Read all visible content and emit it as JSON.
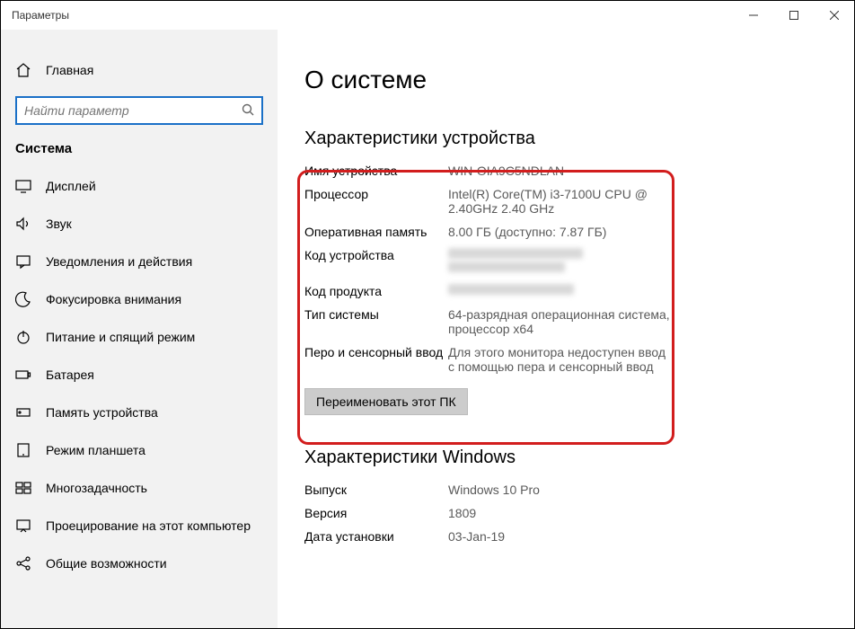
{
  "window": {
    "title": "Параметры"
  },
  "sidebar": {
    "home": "Главная",
    "search_placeholder": "Найти параметр",
    "section": "Система",
    "items": [
      {
        "label": "Дисплей"
      },
      {
        "label": "Звук"
      },
      {
        "label": "Уведомления и действия"
      },
      {
        "label": "Фокусировка внимания"
      },
      {
        "label": "Питание и спящий режим"
      },
      {
        "label": "Батарея"
      },
      {
        "label": "Память устройства"
      },
      {
        "label": "Режим планшета"
      },
      {
        "label": "Многозадачность"
      },
      {
        "label": "Проецирование на этот компьютер"
      },
      {
        "label": "Общие возможности"
      }
    ]
  },
  "main": {
    "title": "О системе",
    "device_specs": {
      "heading": "Характеристики устройства",
      "device_name_label": "Имя устройства",
      "device_name_value": "WIN-OIA9C5NDLAN",
      "processor_label": "Процессор",
      "processor_value": "Intel(R) Core(TM) i3-7100U CPU @ 2.40GHz   2.40 GHz",
      "ram_label": "Оперативная память",
      "ram_value": "8.00 ГБ (доступно: 7.87 ГБ)",
      "device_id_label": "Код устройства",
      "product_id_label": "Код продукта",
      "system_type_label": "Тип системы",
      "system_type_value": "64-разрядная операционная система, процессор x64",
      "pen_touch_label": "Перо и сенсорный ввод",
      "pen_touch_value": "Для этого монитора недоступен ввод с помощью пера и сенсорный ввод"
    },
    "rename_button": "Переименовать этот ПК",
    "windows_specs": {
      "heading": "Характеристики Windows",
      "edition_label": "Выпуск",
      "edition_value": "Windows 10 Pro",
      "version_label": "Версия",
      "version_value": "1809",
      "install_date_label": "Дата установки",
      "install_date_value": "03-Jan-19"
    }
  }
}
